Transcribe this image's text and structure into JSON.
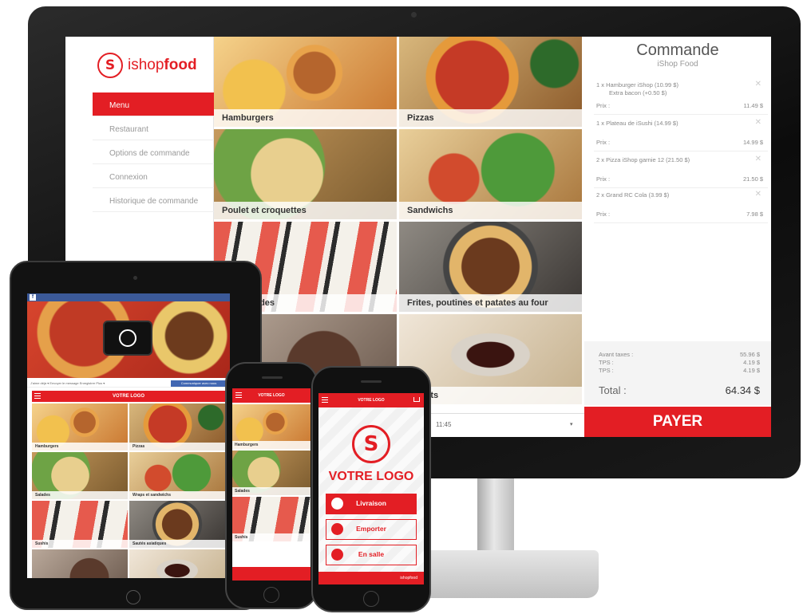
{
  "colors": {
    "brand": "#e31e24",
    "facebook": "#3b5998"
  },
  "desktop": {
    "logo": {
      "badge": "S",
      "brand_light": "ishop",
      "brand_bold": "food",
      "icon": "ishopfood-logo-icon"
    },
    "nav": [
      {
        "label": "Menu",
        "active": true
      },
      {
        "label": "Restaurant"
      },
      {
        "label": "Options de commande"
      },
      {
        "label": "Connexion"
      },
      {
        "label": "Historique de commande"
      }
    ],
    "categories": [
      "Hamburgers",
      "Pizzas",
      "Poulet et croquettes",
      "Sandwichs",
      "s de viandes",
      "Frites, poutines et patates au four",
      "",
      "enfants"
    ],
    "time_value": "11:45",
    "order": {
      "title": "Commande",
      "subtitle": "iShop Food",
      "items": [
        {
          "name": "1 x  Hamburger iShop (10.99 $)",
          "extra": "Extra bacon (+0.50 $)",
          "price_label": "Prix :",
          "price": "11.49 $"
        },
        {
          "name": "1 x Plateau de iSushi (14.99 $)",
          "extra": "",
          "price_label": "Prix :",
          "price": "14.99 $"
        },
        {
          "name": "2 x Pizza iShop garnie 12 (21.50 $)",
          "extra": "",
          "price_label": "Prix :",
          "price": "21.50 $"
        },
        {
          "name": "2 x Grand RC Cola (3.99 $)",
          "extra": "",
          "price_label": "Prix :",
          "price": "7.98 $"
        }
      ],
      "totals": {
        "before_tax_label": "Avant taxes :",
        "before_tax": "55.96 $",
        "tps_label": "TPS :",
        "tps": "4.19 $",
        "tvq_label": "TPS :",
        "tvq": "4.19 $",
        "total_label": "Total :",
        "total": "64.34 $"
      },
      "pay_label": "PAYER"
    }
  },
  "tablet": {
    "fb_icon": "f",
    "fb_actions": "J'aime déjà ▾   Envoyer le message   Enregistrer   Plus ▾",
    "fb_button": "Communiquer avec nous",
    "header": "VOTRE LOGO",
    "categories": [
      "Hamburgers",
      "Pizzas",
      "Salades",
      "Wraps et sandwichs",
      "Sushis",
      "Sautés asiatiques"
    ]
  },
  "phone1": {
    "header": "VOTRE LOGO",
    "categories": [
      "Hamburgers",
      "Salades",
      "Sushis"
    ]
  },
  "phone2": {
    "header": "VOTRE LOGO",
    "badge": "S",
    "logo_text": "VOTRE LOGO",
    "buttons": [
      "Livraison",
      "Emporter",
      "En salle"
    ],
    "footer": "ishopfood"
  }
}
